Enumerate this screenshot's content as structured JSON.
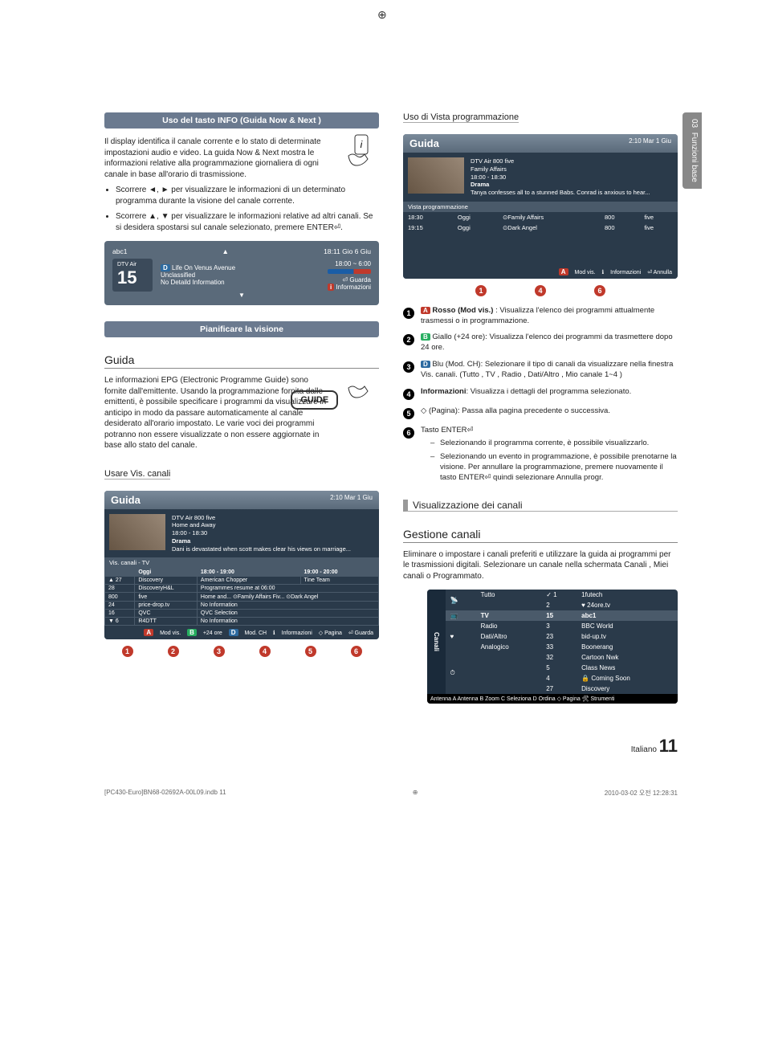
{
  "side_tab": {
    "chapter": "03",
    "label": "Funzioni base"
  },
  "left": {
    "banner1": "Uso del tasto INFO (Guida Now & Next )",
    "intro1": "Il display identifica il canale corrente e lo stato di determinate impostazioni audio e video. La guida Now & Next mostra le informazioni relative alla programmazione giornaliera di ogni canale in base all'orario di trasmissione.",
    "bullet1": "Scorrere ◄, ► per visualizzare le informazioni di un determinato programma durante la visione del canale corrente.",
    "bullet2": "Scorrere ▲, ▼ per visualizzare le informazioni relative ad altri canali. Se si desidera spostarsi sul canale selezionato, premere ENTER⏎.",
    "infobar": {
      "name": "abc1",
      "time_top": "18:11 Gio 6 Giu",
      "service": "DTV Air",
      "num": "15",
      "prog": "Life On Venus Avenue",
      "class": "Unclassified",
      "detail": "No Detaild Information",
      "range": "18:00 ~ 6:00",
      "watch": "⏎ Guarda",
      "info": "Informazioni"
    },
    "banner2": "Pianificare la visione",
    "h_guida": "Guida",
    "intro2": "Le informazioni EPG (Electronic Programme Guide) sono fornite dall'emittente. Usando la programmazione fornita dalle emittenti, è possibile specificare i programmi da visualizzare in anticipo in modo da passare automaticamente al canale desiderato all'orario impostato. Le varie voci dei programmi potranno non essere visualizzate o non essere aggiornate in base allo stato del canale.",
    "guide_btn": "GUIDE",
    "h_usare": "Usare Vis. canali",
    "gbox": {
      "title": "Guida",
      "date": "2:10 Mar 1 Giu",
      "meta1": "DTV Air 800 five",
      "meta2": "Home and Away",
      "meta3": "18:00 - 18:30",
      "meta4": "Drama",
      "meta5": "Dani is devastated when scott makes clear his views on marriage...",
      "tab": "Vis. canali - TV",
      "head_today": "Oggi",
      "t1": "18:00 - 19:00",
      "t2": "19:00 - 20:00",
      "rows": [
        {
          "n": "▲ 27",
          "ch": "Discovery",
          "c1": "American Chopper",
          "c2": "Tine Team"
        },
        {
          "n": "28",
          "ch": "DiscoveryH&L",
          "c1": "Programmes resume at 06:00",
          "c2": ""
        },
        {
          "n": "800",
          "ch": "five",
          "c1": "Home and...   ⊙Family Affairs   Fiv...   ⊙Dark Angel",
          "c2": ""
        },
        {
          "n": "24",
          "ch": "price-drop.tv",
          "c1": "No Information",
          "c2": ""
        },
        {
          "n": "16",
          "ch": "QVC",
          "c1": "QVC Selection",
          "c2": ""
        },
        {
          "n": "▼ 6",
          "ch": "R4DTT",
          "c1": "No Information",
          "c2": ""
        }
      ],
      "foot": {
        "a": "Mod vis.",
        "b": "+24 ore",
        "d": "Mod. CH",
        "i": "Informazioni",
        "p": "◇ Pagina",
        "e": "⏎ Guarda"
      }
    }
  },
  "right": {
    "h_vista": "Uso di Vista programmazione",
    "gbox2": {
      "title": "Guida",
      "date": "2:10 Mar 1 Giu",
      "meta1": "DTV Air 800 five",
      "meta2": "Family Affairs",
      "meta3": "18:00 - 18:30",
      "meta4": "Drama",
      "meta5": "Tanya confesses all to a stunned Babs. Conrad is anxious to hear...",
      "tab": "Vista programmazione",
      "rows": [
        {
          "t": "18:30",
          "d": "Oggi",
          "p": "⊙Family Affairs",
          "n": "800",
          "ch": "five"
        },
        {
          "t": "19:15",
          "d": "Oggi",
          "p": "⊙Dark Angel",
          "n": "800",
          "ch": "five"
        }
      ],
      "foot": {
        "a": "Mod vis.",
        "i": "Informazioni",
        "e": "⏎ Annulla"
      }
    },
    "l1_b": "Rosso (Mod vis.)",
    "l1": ": Visualizza l'elenco dei programmi attualmente trasmessi o in programmazione.",
    "l2_b": "Giallo (+24 ore)",
    "l2": ": Visualizza l'elenco dei programmi da trasmettere dopo 24 ore.",
    "l3_b": "Blu (Mod. CH)",
    "l3": ": Selezionare il tipo di canali da visualizzare nella finestra Vis. canali. (Tutto , TV , Radio , Dati/Altro , Mio canale 1~4 )",
    "l4_b": "Informazioni",
    "l4": ": Visualizza i dettagli del programma selezionato.",
    "l5_b": "◇ (Pagina):",
    "l5": " Passa alla pagina precedente o successiva.",
    "l6_b": "Tasto ENTER⏎",
    "l6a": "Selezionando il programma corrente, è possibile visualizzarlo.",
    "l6b": "Selezionando un evento in programmazione, è possibile prenotarne la visione. Per annullare la programmazione, premere nuovamente il tasto ENTER⏎ quindi selezionare Annulla progr.",
    "h_viscanali": "Visualizzazione dei canali",
    "h_gest": "Gestione canali",
    "p_gest": "Eliminare o impostare i canali preferiti e utilizzare la guida ai programmi per le trasmissioni digitali. Selezionare un canale nella schermata Canali , Miei canali o Programmato.",
    "cm": {
      "side": "Canali",
      "lcol": [
        "Tutto",
        "TV",
        "Radio",
        "Dati/Altro",
        "Analogico"
      ],
      "nums": [
        "✓ 1",
        "2",
        "15",
        "3",
        "23",
        "33",
        "32",
        "5",
        "4",
        "27"
      ],
      "names": [
        "1futech",
        "♥ 24ore.tv",
        "abc1",
        "BBC World",
        "bid-up.tv",
        "Boonerang",
        "Cartoon Nwk",
        "Class News",
        "🔒 Coming Soon",
        "Discovery"
      ],
      "foot": "Antenna   A Antenna   B Zoom   C Seleziona   D Ordina ◇ Pagina 🛠 Strumenti"
    }
  },
  "page": {
    "lang": "Italiano",
    "num": "11"
  },
  "footer": {
    "file": "[PC430-Euro]BN68-02692A-00L09.indb   11",
    "ts": "2010-03-02   오전 12:28:31"
  }
}
